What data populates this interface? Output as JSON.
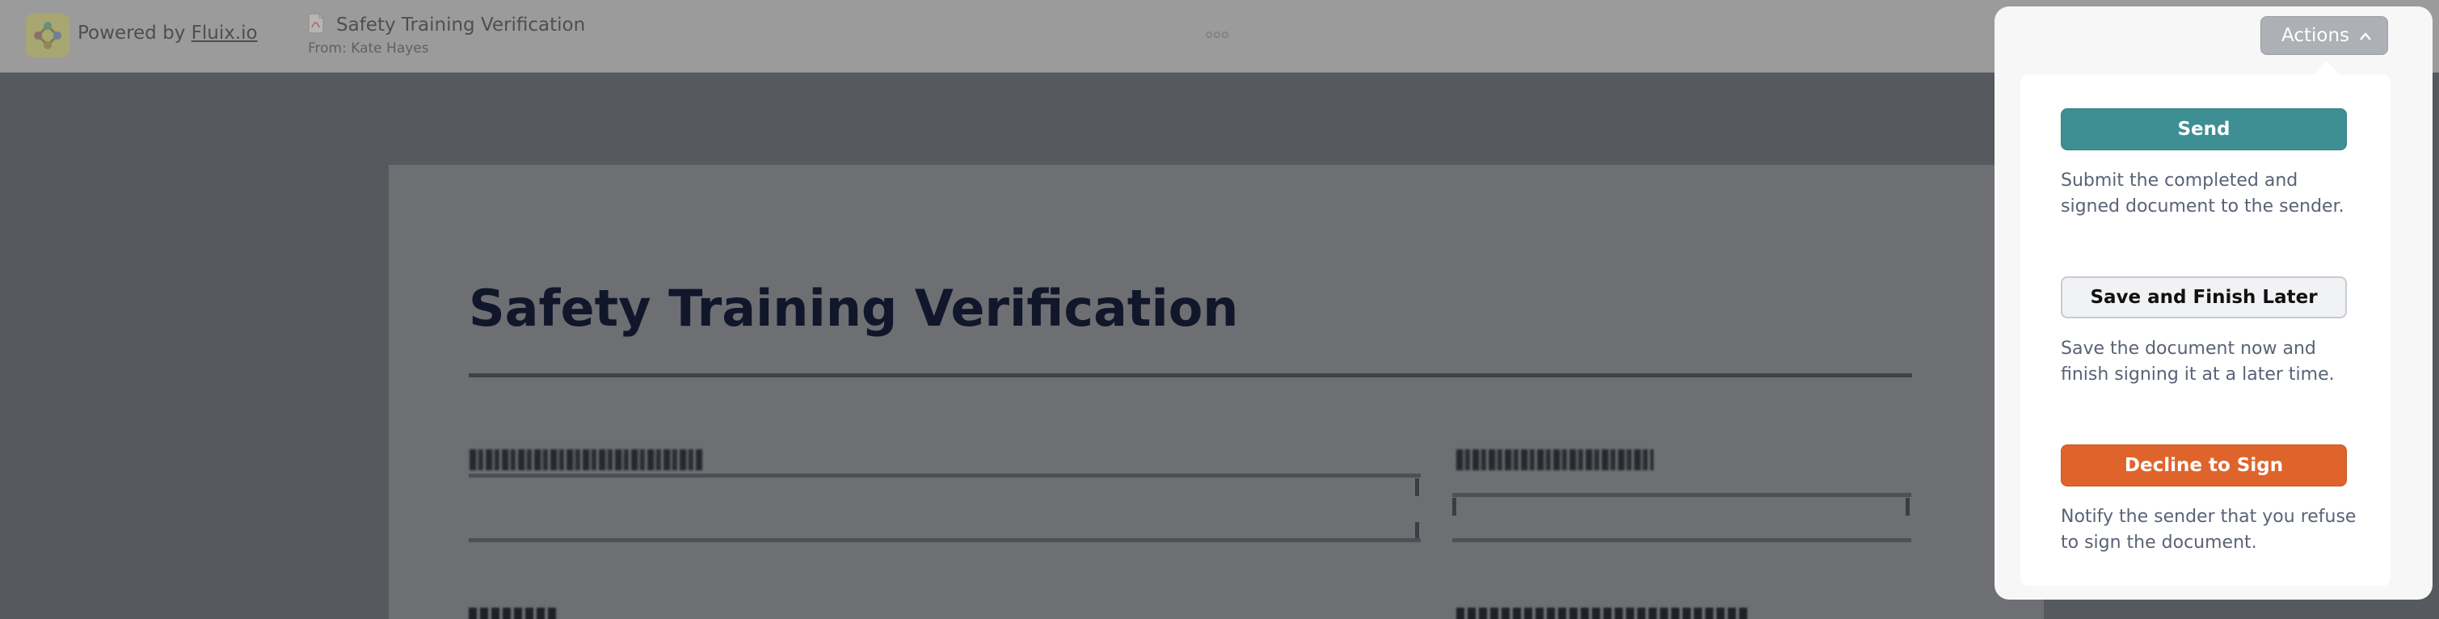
{
  "header": {
    "powered_prefix": "Powered by",
    "powered_link": "Fluix.io",
    "document_title": "Safety Training Verification",
    "document_from": "From: Kate Hayes",
    "logo_icon": "fluix-logo-icon",
    "more_icon": "more-horizontal-icon"
  },
  "document": {
    "heading": "Safety Training Verification"
  },
  "actions": {
    "toggle_label": "Actions",
    "items": [
      {
        "label": "Send",
        "description": "Submit the completed and signed document to the sender.",
        "color": "#3d8f93"
      },
      {
        "label": "Save and Finish Later",
        "description": "Save the document now and finish signing it at a later time.",
        "color": "#f1f2f4"
      },
      {
        "label": "Decline to Sign",
        "description": "Notify the sender that you refuse to sign the document.",
        "color": "#df642b"
      }
    ]
  }
}
